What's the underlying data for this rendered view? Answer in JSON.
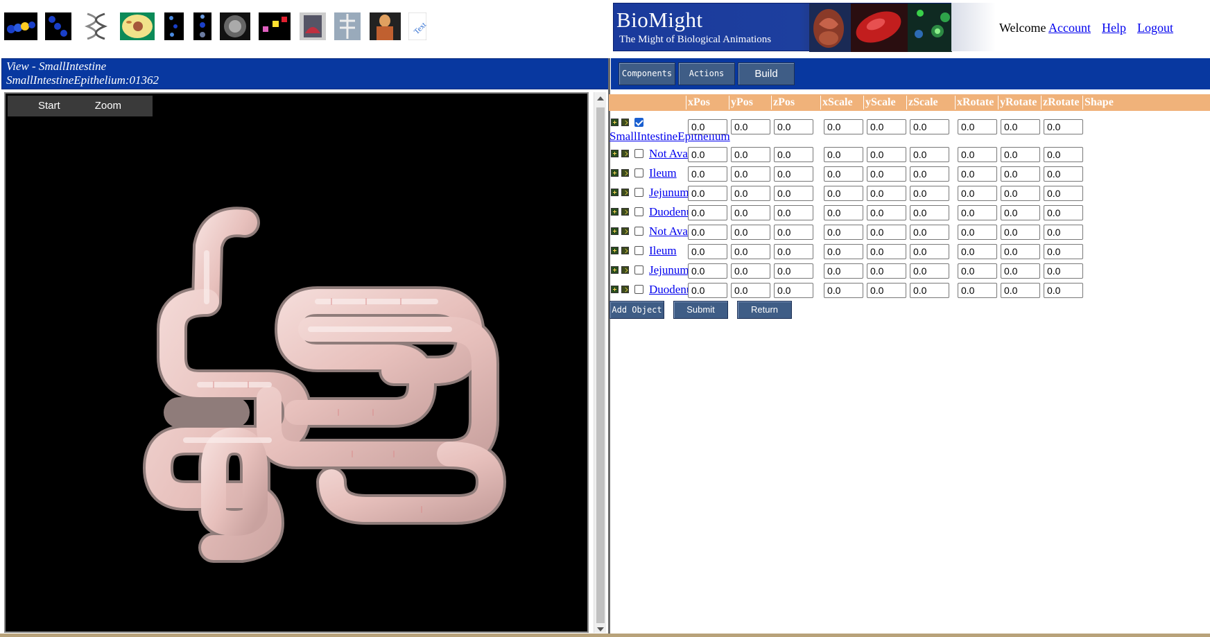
{
  "toolbar_icons": [
    {
      "name": "molecule-icon"
    },
    {
      "name": "chain-icon"
    },
    {
      "name": "dna-helix-icon"
    },
    {
      "name": "cell-icon"
    },
    {
      "name": "particles-icon"
    },
    {
      "name": "atoms-icon"
    },
    {
      "name": "sphere-icon"
    },
    {
      "name": "tissue-blocks-icon"
    },
    {
      "name": "organ-icon"
    },
    {
      "name": "skeleton-icon"
    },
    {
      "name": "human-body-icon"
    },
    {
      "name": "text-icon"
    }
  ],
  "banner": {
    "title": "BioMight",
    "subtitle": "The Might of Biological Animations"
  },
  "user": {
    "welcome": "Welcome",
    "account": "Account",
    "help": "Help",
    "logout": "Logout"
  },
  "view": {
    "line1": "View - SmallIntestine",
    "line2": "SmallIntestineEpithelium:01362",
    "toolbar_start": "Start",
    "toolbar_zoom": "Zoom"
  },
  "actions": {
    "components": "Components",
    "actions": "Actions",
    "build": "Build"
  },
  "grid": {
    "columns": [
      "xPos",
      "yPos",
      "zPos",
      "xScale",
      "yScale",
      "zScale",
      "xRotate",
      "yRotate",
      "zRotate",
      "Shape"
    ],
    "rows": [
      {
        "label": "SmallIntestineEpithelium",
        "checked": true,
        "values": [
          "0.0",
          "0.0",
          "0.0",
          "0.0",
          "0.0",
          "0.0",
          "0.0",
          "0.0",
          "0.0"
        ]
      },
      {
        "label": "Not Available",
        "checked": false,
        "values": [
          "0.0",
          "0.0",
          "0.0",
          "0.0",
          "0.0",
          "0.0",
          "0.0",
          "0.0",
          "0.0"
        ]
      },
      {
        "label": "Ileum",
        "checked": false,
        "values": [
          "0.0",
          "0.0",
          "0.0",
          "0.0",
          "0.0",
          "0.0",
          "0.0",
          "0.0",
          "0.0"
        ]
      },
      {
        "label": "Jejunum",
        "checked": false,
        "values": [
          "0.0",
          "0.0",
          "0.0",
          "0.0",
          "0.0",
          "0.0",
          "0.0",
          "0.0",
          "0.0"
        ]
      },
      {
        "label": "Duodenum",
        "checked": false,
        "values": [
          "0.0",
          "0.0",
          "0.0",
          "0.0",
          "0.0",
          "0.0",
          "0.0",
          "0.0",
          "0.0"
        ]
      },
      {
        "label": "Not Available",
        "checked": false,
        "values": [
          "0.0",
          "0.0",
          "0.0",
          "0.0",
          "0.0",
          "0.0",
          "0.0",
          "0.0",
          "0.0"
        ]
      },
      {
        "label": "Ileum",
        "checked": false,
        "values": [
          "0.0",
          "0.0",
          "0.0",
          "0.0",
          "0.0",
          "0.0",
          "0.0",
          "0.0",
          "0.0"
        ]
      },
      {
        "label": "Jejunum",
        "checked": false,
        "values": [
          "0.0",
          "0.0",
          "0.0",
          "0.0",
          "0.0",
          "0.0",
          "0.0",
          "0.0",
          "0.0"
        ]
      },
      {
        "label": "Duodenum",
        "checked": false,
        "values": [
          "0.0",
          "0.0",
          "0.0",
          "0.0",
          "0.0",
          "0.0",
          "0.0",
          "0.0",
          "0.0"
        ]
      }
    ]
  },
  "form_buttons": {
    "add_object": "Add Object",
    "submit": "Submit",
    "return": "Return"
  },
  "colors": {
    "header_blue": "#0838a0",
    "grid_header": "#f0b27a",
    "button": "#3f5d86",
    "link": "#0000ee"
  }
}
